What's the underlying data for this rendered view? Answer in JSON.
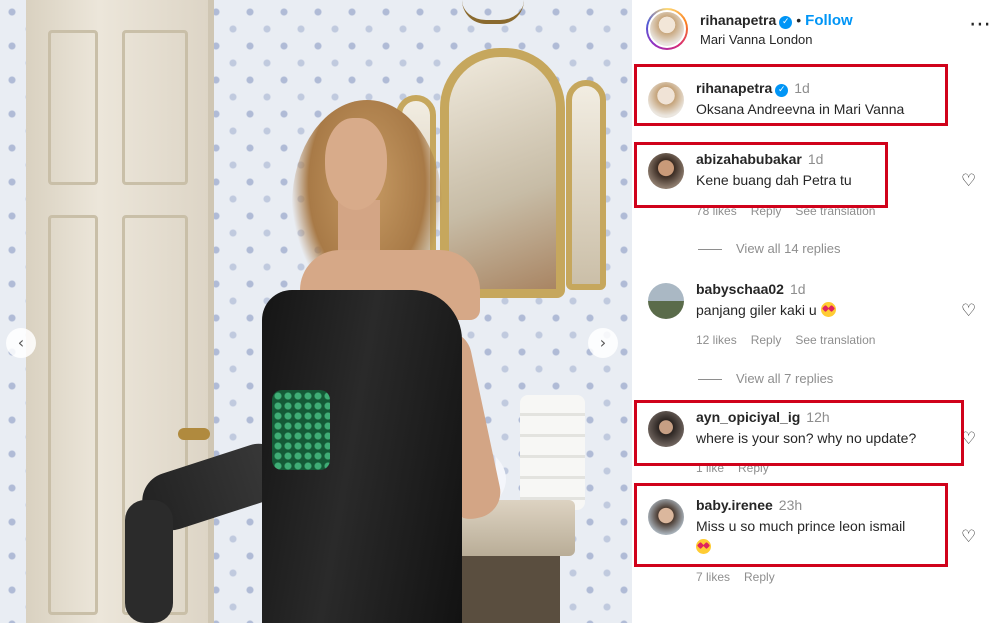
{
  "header": {
    "username": "rihanapetra",
    "follow_label": "Follow",
    "location": "Mari Vanna London",
    "more_icon": "more-horizontal-icon"
  },
  "photo": {
    "prev_icon": "chevron-left-icon",
    "next_icon": "chevron-right-icon"
  },
  "caption": {
    "username": "rihanapetra",
    "time": "1d",
    "text": "Oksana Andreevna in Mari Vanna"
  },
  "comments": [
    {
      "username": "abizahabubakar",
      "time": "1d",
      "text": "Kene buang dah Petra tu",
      "likes": "78 likes",
      "reply": "Reply",
      "translate": "See translation",
      "view_replies": "View all 14 replies"
    },
    {
      "username": "babyschaa02",
      "time": "1d",
      "text": "panjang giler kaki u",
      "likes": "12 likes",
      "reply": "Reply",
      "translate": "See translation",
      "view_replies": "View all 7 replies"
    },
    {
      "username": "ayn_opiciyal_ig",
      "time": "12h",
      "text": "where is your son? why no update?",
      "likes": "1 like",
      "reply": "Reply"
    },
    {
      "username": "baby.irenee",
      "time": "23h",
      "text": "Miss u so much prince leon ismail",
      "likes": "7 likes",
      "reply": "Reply"
    }
  ],
  "colors": {
    "highlight": "#d0021b",
    "link_blue": "#0095f6",
    "muted_text": "#8e8e8e"
  }
}
